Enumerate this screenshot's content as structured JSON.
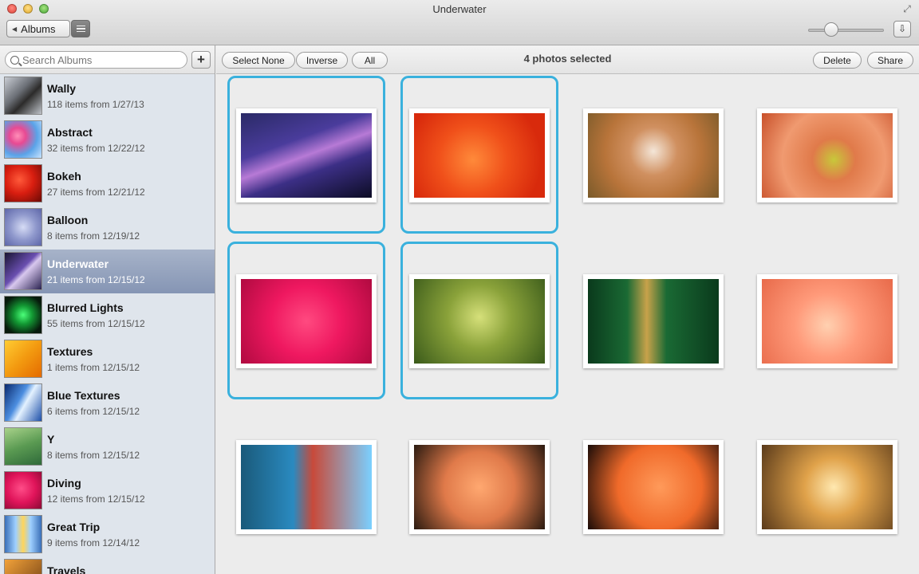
{
  "window": {
    "title": "Underwater"
  },
  "toolbar": {
    "albums_label": "Albums",
    "zoom_level": 0.3
  },
  "sidebar": {
    "search_placeholder": "Search Albums",
    "add_label": "+",
    "albums": [
      {
        "name": "Wally",
        "meta": "118 items from 1/27/13",
        "thumb": "linear-gradient(135deg,#c9cdd4 0%,#6b6f76 40%,#2c2b2a 60%,#bfc3c9 100%)",
        "selected": false
      },
      {
        "name": "Abstract",
        "meta": "32 items from 12/22/12",
        "thumb": "radial-gradient(circle at 35% 40%,#ff8fb8 0%,#e84a93 25%,#5aa3e8 60%,#c8e4ff 100%)",
        "selected": false
      },
      {
        "name": "Bokeh",
        "meta": "27 items from 12/21/12",
        "thumb": "radial-gradient(circle at 40% 40%,#ff5a3a 0%,#d91e10 45%,#6a0a05 100%)",
        "selected": false
      },
      {
        "name": "Balloon",
        "meta": "8 items from 12/19/12",
        "thumb": "radial-gradient(circle at 50% 50%,#d6dcf5 0%,#8f98cc 50%,#5d66a8 100%)",
        "selected": false
      },
      {
        "name": "Underwater",
        "meta": "21 items from 12/15/12",
        "thumb": "linear-gradient(135deg,#1a1533 0%,#6a4fb0 45%,#d8c8ee 55%,#2a2250 100%)",
        "selected": true
      },
      {
        "name": "Blurred Lights",
        "meta": "55 items from 12/15/12",
        "thumb": "radial-gradient(circle at 50% 50%,#4cff7a 0%,#139a34 35%,#071a0c 80%)",
        "selected": false
      },
      {
        "name": "Textures",
        "meta": "1 items from 12/15/12",
        "thumb": "linear-gradient(135deg,#ffcc33 0%,#f39a10 50%,#e46a00 100%)",
        "selected": false
      },
      {
        "name": "Blue Textures",
        "meta": "6 items from 12/15/12",
        "thumb": "linear-gradient(120deg,#0b2a6e 0%,#4c8ee0 40%,#e4f2ff 55%,#1d4fa8 100%)",
        "selected": false
      },
      {
        "name": "Y",
        "meta": "8 items from 12/15/12",
        "thumb": "linear-gradient(160deg,#a8d28a 0%,#5a9a52 50%,#2f6a3a 100%)",
        "selected": false
      },
      {
        "name": "Diving",
        "meta": "12 items from 12/15/12",
        "thumb": "radial-gradient(circle at 45% 45%,#ff4d88 0%,#e0145a 50%,#8a0a34 100%)",
        "selected": false
      },
      {
        "name": "Great Trip",
        "meta": "9 items from 12/14/12",
        "thumb": "linear-gradient(90deg,#3a6fb8 0%,#9fd0ff 30%,#ffd55a 50%,#9fd0ff 70%,#3a6fb8 100%)",
        "selected": false
      },
      {
        "name": "Travels",
        "meta": "",
        "thumb": "linear-gradient(135deg,#f2a23a 0%,#6a3a12 100%)",
        "selected": false
      }
    ]
  },
  "actions": {
    "select_none": "Select None",
    "inverse": "Inverse",
    "all": "All",
    "status": "4 photos selected",
    "delete": "Delete",
    "share": "Share"
  },
  "photos": [
    {
      "fill": "linear-gradient(160deg,#2a2a66 0%,#4a3c9c 35%,#b77ad6 50%,#3c2f86 65%,#0c0c24 100%)",
      "selected": true
    },
    {
      "fill": "radial-gradient(circle at 45% 55%,#ff8a3a 0%,#f0501a 40%,#d82a0c 80%)",
      "selected": true
    },
    {
      "fill": "radial-gradient(circle at 50% 45%,#f4e6d8 0%,#d09060 30%,#b8743a 60%,#7a5a2a 100%)",
      "selected": false
    },
    {
      "fill": "radial-gradient(circle at 55% 55%,#c8c83a 0%,#e07a4a 25%,#f09a70 60%,#c8502a 100%)",
      "selected": false
    },
    {
      "fill": "radial-gradient(circle at 50% 50%,#ff4a80 0%,#ef1860 45%,#b00a40 100%)",
      "selected": true
    },
    {
      "fill": "radial-gradient(circle at 50% 45%,#d6e07a 0%,#8aa23a 40%,#3a5a1a 100%)",
      "selected": true
    },
    {
      "fill": "linear-gradient(90deg,#0a3a1c 0%,#1a6a34 30%,#c8a24a 45%,#1a6a34 60%,#0a3a1c 100%)",
      "selected": false
    },
    {
      "fill": "radial-gradient(circle at 50% 55%,#ffd0b0 0%,#ff9a7a 40%,#e86a4a 100%)",
      "selected": false
    },
    {
      "fill": "linear-gradient(90deg,#1a5a7a 0%,#2a8ac0 40%,#c84a3a 55%,#7ad0ff 100%)",
      "selected": false
    },
    {
      "fill": "radial-gradient(circle at 50% 50%,#ffa870 0%,#e07a4a 45%,#2a1a10 100%)",
      "selected": false
    },
    {
      "fill": "radial-gradient(circle at 55% 50%,#ff9a5a 0%,#f06a2a 50%,#1a0c08 100%)",
      "selected": false
    },
    {
      "fill": "radial-gradient(circle at 55% 50%,#ffe8b0 0%,#e0a24a 35%,#5a3a1a 100%)",
      "selected": false
    }
  ]
}
